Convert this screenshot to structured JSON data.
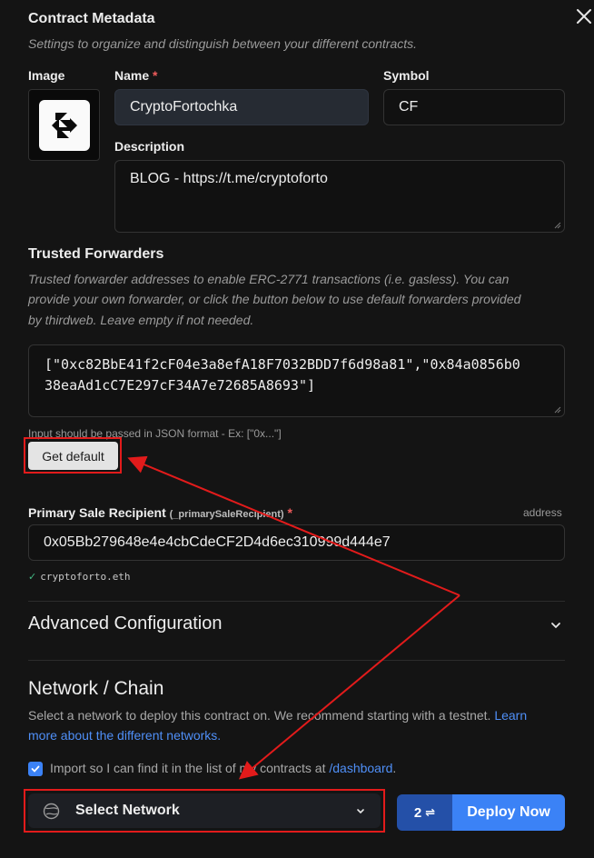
{
  "metadata": {
    "title": "Contract Metadata",
    "subtitle": "Settings to organize and distinguish between your different contracts.",
    "image_label": "Image",
    "name_label": "Name",
    "required_mark": "*",
    "name_value": "CryptoFortochka",
    "symbol_label": "Symbol",
    "symbol_value": "CF",
    "description_label": "Description",
    "description_value": "BLOG - https://t.me/cryptoforto"
  },
  "forwarders": {
    "title": "Trusted Forwarders",
    "help_line1": "Trusted forwarder addresses to enable ERC-2771 transactions (i.e. gasless). You can",
    "help_line2": "provide your own forwarder, or click the button below to use default forwarders provided",
    "help_line3": "by thirdweb. Leave empty if not needed.",
    "value_line1": "[\"0xc82BbE41f2cF04e3a8efA18F7032BDD7f6d98a81\",\"0x84a0856b0",
    "value_line2": "38eaAd1cC7E297cF34A7e72685A8693\"]",
    "hint": "Input should be passed in JSON format - Ex: [\"0x...\"]",
    "get_default_label": "Get default"
  },
  "primary_sale": {
    "label": "Primary Sale Recipient",
    "param": "(_primarySaleRecipient)",
    "required_mark": "*",
    "type": "address",
    "value": "0x05Bb279648e4e4cbCdeCF2D4d6ec310999d444e7",
    "resolved_check": "✓",
    "resolved_name": "cryptoforto.eth"
  },
  "advanced": {
    "title": "Advanced Configuration"
  },
  "network": {
    "title": "Network / Chain",
    "desc_part1": "Select a network to deploy this contract on. We recommend starting with a testnet.",
    "learn_word": "Learn",
    "learn_rest": "more about the different networks.",
    "import_text": "Import so I can find it in the list of my contracts at",
    "dashboard_link": "/dashboard",
    "import_end": ".",
    "import_checked": true,
    "select_label": "Select Network",
    "count_label": "2",
    "count_icon": "⇌",
    "deploy_label": "Deploy Now"
  },
  "colors": {
    "background": "#141414",
    "accent": "#3b82f6",
    "annotation": "#e21b1b"
  },
  "icons": {
    "close": "close-icon",
    "logo": "thirdweb-logo",
    "chevron": "chevron-down-icon",
    "globe": "globe-icon",
    "check": "check-icon"
  }
}
